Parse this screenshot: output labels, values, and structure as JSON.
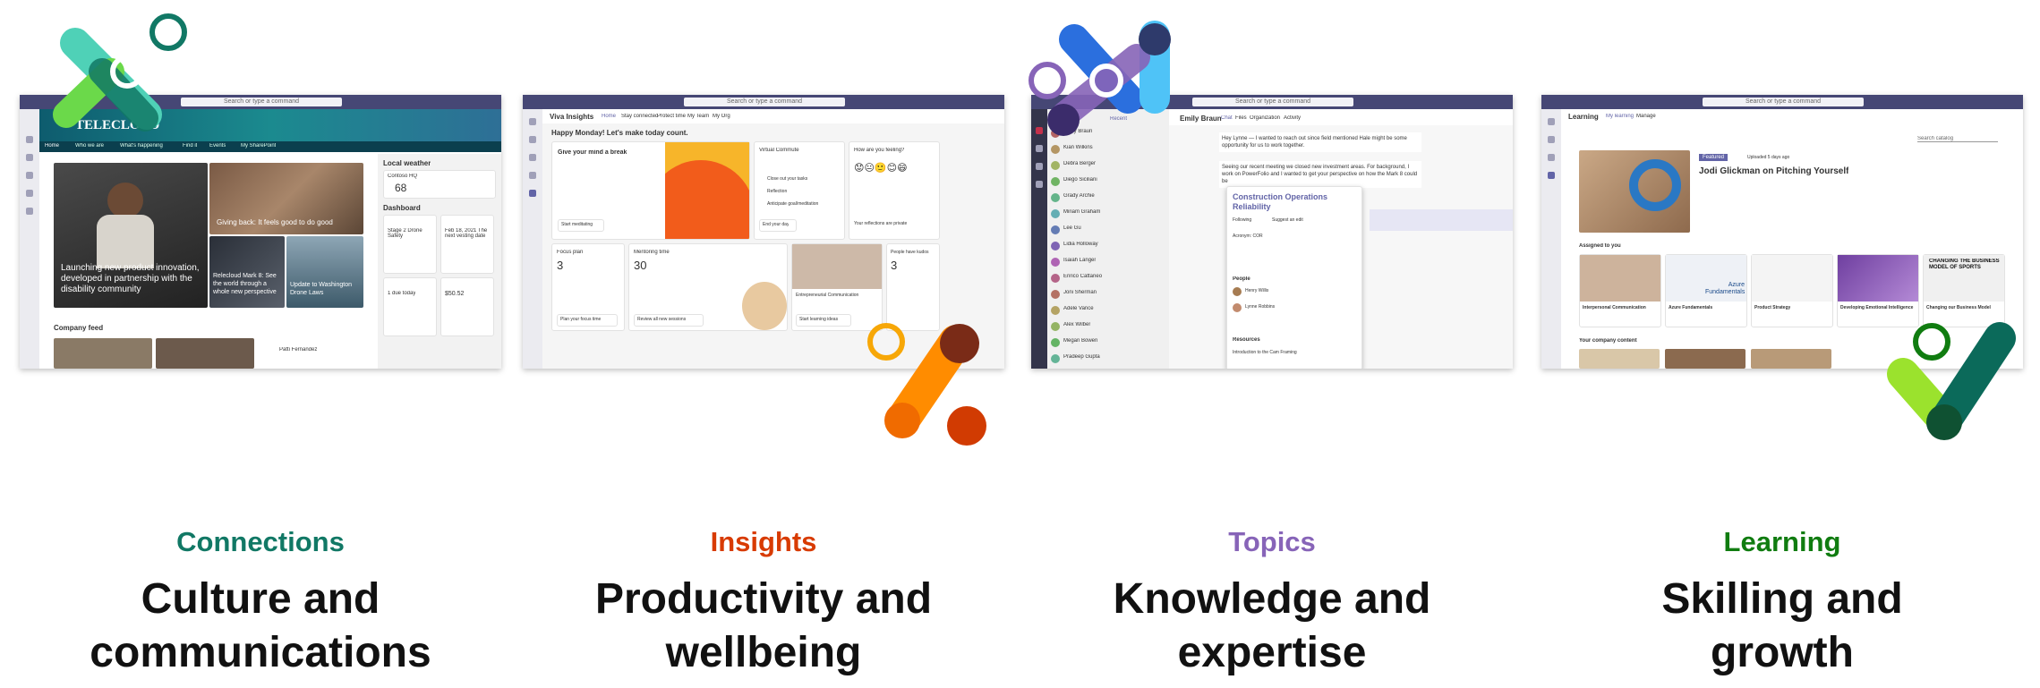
{
  "colors": {
    "connections": "#117865",
    "insights": "#d83b01",
    "topics": "#8764b8",
    "learning": "#107c10"
  },
  "panels": {
    "connections": {
      "category": "Connections",
      "subtitle_line1": "Culture and",
      "subtitle_line2": "communications"
    },
    "insights": {
      "category": "Insights",
      "subtitle_line1": "Productivity and",
      "subtitle_line2": "wellbeing"
    },
    "topics": {
      "category": "Topics",
      "subtitle_line1": "Knowledge and",
      "subtitle_line2": "expertise"
    },
    "learning": {
      "category": "Learning",
      "subtitle_line1": "Skilling and",
      "subtitle_line2": "growth"
    }
  },
  "shot_connections": {
    "search": "Search or type a command",
    "banner": "TELECLOUD",
    "nav": [
      "Home",
      "Who we are",
      "What's happening",
      "Find it",
      "Events",
      "My SharePoint"
    ],
    "hero": "Launching new product innovation, developed in partnership with the disability community",
    "tile1": "Giving back: It feels good to do good",
    "tile2": "Relecloud Mark 8: See the world through a whole new perspective",
    "tile3": "Update to Washington Drone Laws",
    "weather_title": "Local weather",
    "weather_city": "Contoso HQ",
    "weather_temp": "68",
    "dashboard": "Dashboard",
    "dash1": "Stage 2 Drone Safety",
    "dash2": "Feb 18, 2021 The next vesting date",
    "dash3": "1 due today",
    "dash4": "$50.52",
    "feed": "Company feed",
    "person": "Patti Fernandez"
  },
  "shot_insights": {
    "search": "Search or type a command",
    "app": "Viva Insights",
    "tabs": [
      "Home",
      "Stay connected",
      "Protect time",
      "My Team",
      "My Org"
    ],
    "greeting": "Happy Monday! Let's make today count.",
    "break_title": "Give your mind a break",
    "break_btn": "Start meditating",
    "commute_title": "Virtual Commute",
    "commute1": "Close out your tasks",
    "commute2": "Reflection",
    "commute3": "Anticipate goal/meditation",
    "commute_btn": "End your day",
    "feel_title": "How are you feeling?",
    "feel_btn": "Your reflections are private",
    "focus_title": "Focus plan",
    "focus_value": "3",
    "focus_btn": "Plan your focus time",
    "meet_title": "Mentoring time",
    "meet_value": "30",
    "meet_btn": "Review all new sessions",
    "ent_title": "Entrepreneurial Communication",
    "ent_btn": "Start learning ideas",
    "people_title": "People have kudos",
    "people_value": "3"
  },
  "shot_topics": {
    "search": "Search or type a command",
    "chat_title": "Emily Braun",
    "chat_tabs": [
      "Chat",
      "Files",
      "Organization",
      "Activity"
    ],
    "sidebar_tab": "Recent",
    "contacts": [
      "Emily Braun",
      "Kian Wilkins",
      "Debra Berger",
      "Diego Siciliani",
      "Grady Archie",
      "Miriam Graham",
      "Lee Gu",
      "Lidia Holloway",
      "Isaiah Langer",
      "Enrico Cattaneo",
      "Joni Sherman",
      "Adele Vance",
      "Alex Wilber",
      "Megan Bowen",
      "Pradeep Gupta"
    ],
    "msg1": "Hey Lynne — I wanted to reach out since field mentioned Hale might be some opportunity for us to work together.",
    "msg2": "Seeing our recent meeting we closed new investment areas. For background, I work on PowerFolio and I wanted to get your perspective on how the Mark 8 could be",
    "card_title": "Construction Operations Reliability",
    "card_follow": "Following",
    "card_suggest": "Suggest an edit",
    "card_acronym": "Acronym: COR",
    "card_people": "People",
    "card_person1": "Henry Willis",
    "card_person2": "Lynne Robbins",
    "card_resources": "Resources",
    "card_resource1": "Introduction to the Cam Framing"
  },
  "shot_learning": {
    "search": "Search or type a command",
    "app": "Learning",
    "tabs": [
      "My learning",
      "Manage"
    ],
    "search_catalog": "Search catalog",
    "badge": "Featured",
    "uploaded": "Uploaded 5 days ago",
    "featured_title": "Jodi Glickman on Pitching Yourself",
    "assigned": "Assigned to you",
    "courses": [
      "Interpersonal Communication",
      "Azure Fundamentals",
      "Product Strategy",
      "Developing Emotional Intelligence",
      "Changing our Business Model"
    ],
    "azure_thumb": "Azure Fundamentals",
    "business_thumb": "CHANGING THE BUSINESS MODEL OF SPORTS",
    "company": "Your company content"
  }
}
